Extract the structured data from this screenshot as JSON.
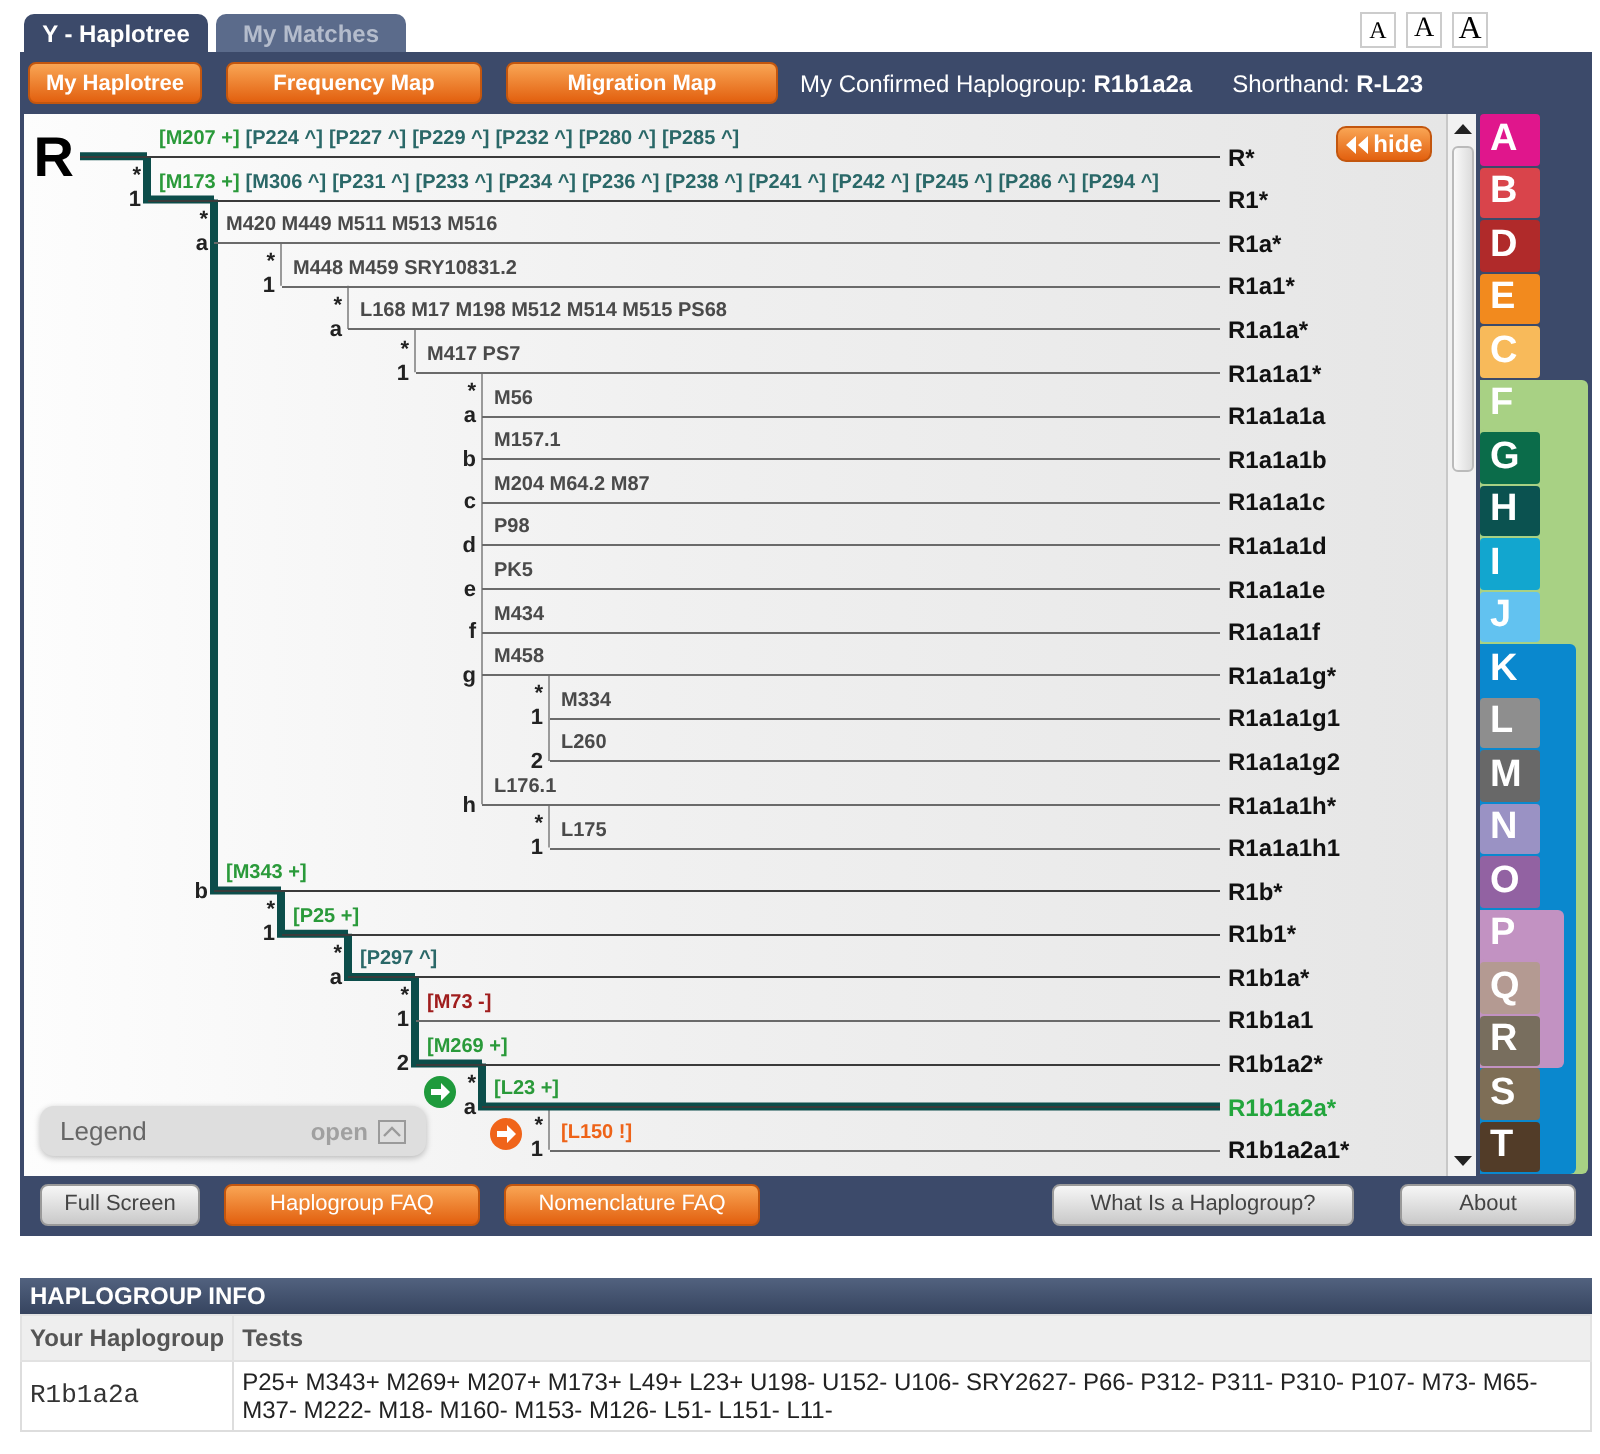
{
  "tabs": [
    {
      "label": "Y - Haplotree",
      "selected": true
    },
    {
      "label": "My Matches",
      "selected": false
    }
  ],
  "font_sizes": [
    "A",
    "A",
    "A"
  ],
  "toolbar": {
    "buttons": [
      "My Haplotree",
      "Frequency Map",
      "Migration Map"
    ],
    "confirmed": "My Confirmed Haplogroup: **R1b1a2a**",
    "shorthand": "Shorthand: **R-L23**"
  },
  "tree": {
    "hide_button": "hide",
    "legend": {
      "title": "Legend",
      "action": "open"
    },
    "root": {
      "branch": "R",
      "on_path": true,
      "selected": false,
      "label": "R*",
      "markers": [
        {
          "text": "[M207 +]",
          "kind": "positive"
        },
        {
          "text": "[P224 ^]",
          "kind": "implied"
        },
        {
          "text": "[P227 ^]",
          "kind": "implied"
        },
        {
          "text": "[P229 ^]",
          "kind": "implied"
        },
        {
          "text": "[P232 ^]",
          "kind": "implied"
        },
        {
          "text": "[P280 ^]",
          "kind": "implied"
        },
        {
          "text": "[P285 ^]",
          "kind": "implied"
        }
      ],
      "children": [
        {
          "star": "*",
          "branch": "1",
          "on_path": true,
          "selected": false,
          "label": "R1*",
          "markers": [
            {
              "text": "[M173 +]",
              "kind": "positive"
            },
            {
              "text": "[M306 ^]",
              "kind": "implied"
            },
            {
              "text": "[P231 ^]",
              "kind": "implied"
            },
            {
              "text": "[P233 ^]",
              "kind": "implied"
            },
            {
              "text": "[P234 ^]",
              "kind": "implied"
            },
            {
              "text": "[P236 ^]",
              "kind": "implied"
            },
            {
              "text": "[P238 ^]",
              "kind": "implied"
            },
            {
              "text": "[P241 ^]",
              "kind": "implied"
            },
            {
              "text": "[P242 ^]",
              "kind": "implied"
            },
            {
              "text": "[P245 ^]",
              "kind": "implied"
            },
            {
              "text": "[P286 ^]",
              "kind": "implied"
            },
            {
              "text": "[P294 ^]",
              "kind": "implied"
            }
          ],
          "children": [
            {
              "star": "*",
              "branch": "a",
              "on_path": false,
              "selected": false,
              "label": "R1a*",
              "markers": [
                {
                  "text": "M420 M449 M511 M513 M516",
                  "kind": "plain"
                }
              ],
              "children": [
                {
                  "star": "*",
                  "branch": "1",
                  "on_path": false,
                  "selected": false,
                  "label": "R1a1*",
                  "markers": [
                    {
                      "text": "M448 M459 SRY10831.2",
                      "kind": "plain"
                    }
                  ],
                  "children": [
                    {
                      "star": "*",
                      "branch": "a",
                      "on_path": false,
                      "selected": false,
                      "label": "R1a1a*",
                      "markers": [
                        {
                          "text": "L168 M17 M198 M512 M514 M515 PS68",
                          "kind": "plain"
                        }
                      ],
                      "children": [
                        {
                          "star": "*",
                          "branch": "1",
                          "on_path": false,
                          "selected": false,
                          "label": "R1a1a1*",
                          "markers": [
                            {
                              "text": "M417 PS7",
                              "kind": "plain"
                            }
                          ],
                          "children": [
                            {
                              "star": "*",
                              "branch": "a",
                              "on_path": false,
                              "selected": false,
                              "label": "R1a1a1a",
                              "markers": [
                                {
                                  "text": "M56",
                                  "kind": "plain"
                                }
                              ]
                            },
                            {
                              "branch": "b",
                              "on_path": false,
                              "selected": false,
                              "label": "R1a1a1b",
                              "markers": [
                                {
                                  "text": "M157.1",
                                  "kind": "plain"
                                }
                              ]
                            },
                            {
                              "branch": "c",
                              "on_path": false,
                              "selected": false,
                              "label": "R1a1a1c",
                              "markers": [
                                {
                                  "text": "M204 M64.2 M87",
                                  "kind": "plain"
                                }
                              ]
                            },
                            {
                              "branch": "d",
                              "on_path": false,
                              "selected": false,
                              "label": "R1a1a1d",
                              "markers": [
                                {
                                  "text": "P98",
                                  "kind": "plain"
                                }
                              ]
                            },
                            {
                              "branch": "e",
                              "on_path": false,
                              "selected": false,
                              "label": "R1a1a1e",
                              "markers": [
                                {
                                  "text": "PK5",
                                  "kind": "plain"
                                }
                              ]
                            },
                            {
                              "branch": "f",
                              "on_path": false,
                              "selected": false,
                              "label": "R1a1a1f",
                              "markers": [
                                {
                                  "text": "M434",
                                  "kind": "plain"
                                }
                              ]
                            },
                            {
                              "branch": "g",
                              "on_path": false,
                              "selected": false,
                              "label": "R1a1a1g*",
                              "markers": [
                                {
                                  "text": "M458",
                                  "kind": "plain"
                                }
                              ],
                              "children": [
                                {
                                  "star": "*",
                                  "branch": "1",
                                  "on_path": false,
                                  "selected": false,
                                  "label": "R1a1a1g1",
                                  "markers": [
                                    {
                                      "text": "M334",
                                      "kind": "plain"
                                    }
                                  ]
                                },
                                {
                                  "branch": "2",
                                  "on_path": false,
                                  "selected": false,
                                  "label": "R1a1a1g2",
                                  "markers": [
                                    {
                                      "text": "L260",
                                      "kind": "plain"
                                    }
                                  ]
                                }
                              ]
                            },
                            {
                              "branch": "h",
                              "on_path": false,
                              "selected": false,
                              "label": "R1a1a1h*",
                              "markers": [
                                {
                                  "text": "L176.1",
                                  "kind": "plain"
                                }
                              ],
                              "children": [
                                {
                                  "star": "*",
                                  "branch": "1",
                                  "on_path": false,
                                  "selected": false,
                                  "label": "R1a1a1h1",
                                  "markers": [
                                    {
                                      "text": "L175",
                                      "kind": "plain"
                                    }
                                  ]
                                }
                              ]
                            }
                          ]
                        }
                      ]
                    }
                  ]
                }
              ]
            },
            {
              "branch": "b",
              "on_path": true,
              "selected": false,
              "label": "R1b*",
              "markers": [
                {
                  "text": "[M343 +]",
                  "kind": "positive"
                }
              ],
              "children": [
                {
                  "star": "*",
                  "branch": "1",
                  "on_path": true,
                  "selected": false,
                  "label": "R1b1*",
                  "markers": [
                    {
                      "text": "[P25 +]",
                      "kind": "positive"
                    }
                  ],
                  "children": [
                    {
                      "star": "*",
                      "branch": "a",
                      "on_path": true,
                      "selected": false,
                      "label": "R1b1a*",
                      "markers": [
                        {
                          "text": "[P297 ^]",
                          "kind": "implied"
                        }
                      ],
                      "children": [
                        {
                          "star": "*",
                          "branch": "1",
                          "on_path": false,
                          "selected": false,
                          "label": "R1b1a1",
                          "markers": [
                            {
                              "text": "[M73 -]",
                              "kind": "negative"
                            }
                          ]
                        },
                        {
                          "branch": "2",
                          "on_path": true,
                          "selected": false,
                          "label": "R1b1a2*",
                          "markers": [
                            {
                              "text": "[M269 +]",
                              "kind": "positive"
                            }
                          ],
                          "children": [
                            {
                              "star": "*",
                              "branch": "a",
                              "on_path": true,
                              "selected": true,
                              "arrow": {
                                "color": "#1f9a3c"
                              },
                              "label": "R1b1a2a*",
                              "markers": [
                                {
                                  "text": "[L23 +]",
                                  "kind": "positive"
                                }
                              ],
                              "children": [
                                {
                                  "star": "*",
                                  "branch": "1",
                                  "on_path": false,
                                  "selected": false,
                                  "arrow": {
                                    "color": "#f0641a"
                                  },
                                  "label": "R1b1a2a1*",
                                  "markers": [
                                    {
                                      "text": "[L150 !]",
                                      "kind": "warning"
                                    }
                                  ]
                                }
                              ]
                            }
                          ]
                        }
                      ]
                    }
                  ]
                }
              ]
            }
          ]
        }
      ]
    }
  },
  "haplogroup_tabs": [
    {
      "label": "A",
      "color": "#e0168c"
    },
    {
      "label": "B",
      "color": "#d9444b"
    },
    {
      "label": "D",
      "color": "#b02a2a"
    },
    {
      "label": "E",
      "color": "#f28a1e"
    },
    {
      "label": "C",
      "color": "#f8ba5a"
    },
    {
      "label": "F",
      "color": "#a8d184",
      "children": [
        {
          "label": "G",
          "color": "#0b6c4a"
        },
        {
          "label": "H",
          "color": "#0b5250"
        },
        {
          "label": "I",
          "color": "#12a6cf"
        },
        {
          "label": "J",
          "color": "#62c2f0"
        },
        {
          "label": "K",
          "color": "#0a88ce",
          "children": [
            {
              "label": "L",
              "color": "#8e8e8e"
            },
            {
              "label": "M",
              "color": "#686868"
            },
            {
              "label": "N",
              "color": "#9a92c4"
            },
            {
              "label": "O",
              "color": "#9262a2"
            },
            {
              "label": "P",
              "color": "#c292c2",
              "children": [
                {
                  "label": "Q",
                  "color": "#b49a92"
                },
                {
                  "label": "R",
                  "color": "#786e5e"
                }
              ]
            },
            {
              "label": "S",
              "color": "#7e6e56"
            },
            {
              "label": "T",
              "color": "#523c28"
            }
          ]
        }
      ]
    }
  ],
  "bottom_bar": [
    {
      "label": "Full Screen",
      "kind": "plain"
    },
    {
      "label": "Haplogroup FAQ",
      "kind": "accent"
    },
    {
      "label": "Nomenclature FAQ",
      "kind": "accent"
    },
    {
      "label": "What Is a Haplogroup?",
      "kind": "plain"
    },
    {
      "label": "About",
      "kind": "plain"
    }
  ],
  "info": {
    "title": "HAPLOGROUP INFO",
    "columns": [
      "Your Haplogroup",
      "Tests"
    ],
    "rows": [
      [
        "R1b1a2a",
        "P25+ M343+ M269+ M207+ M173+ L49+ L23+ U198- U152- U106- SRY2627- P66- P312- P311- P310- P107- M73- M65- M37- M222- M18- M160- M153- M126- L51- L151- L11-"
      ]
    ]
  }
}
